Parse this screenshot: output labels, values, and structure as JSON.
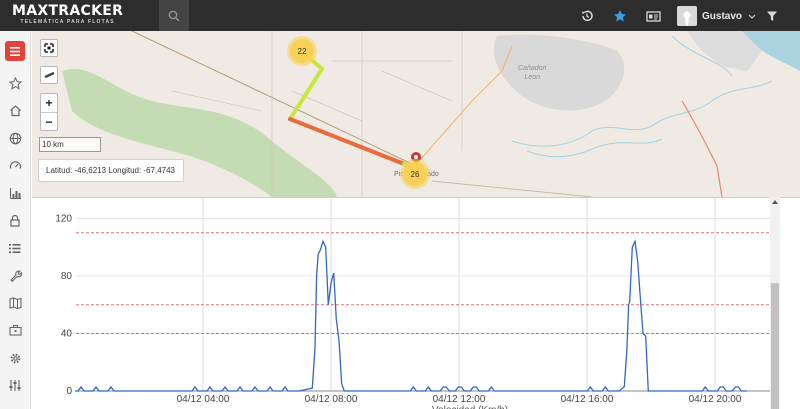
{
  "app": {
    "logo": "MAXTRACKER",
    "tagline": "TELEMÁTICA PARA FLOTAS"
  },
  "topbar": {
    "icons": [
      "search-icon",
      "history-icon",
      "star-icon",
      "id-card-icon",
      "filter-icon"
    ],
    "user_name": "Gustavo",
    "colors": {
      "background": "#2d2d2d",
      "star": "#3aa0e8"
    }
  },
  "sidebar": {
    "items": [
      {
        "name": "menu",
        "icon": "hamburger-icon",
        "active": true
      },
      {
        "name": "favorites",
        "icon": "star-icon"
      },
      {
        "name": "home",
        "icon": "home-icon"
      },
      {
        "name": "globe",
        "icon": "globe-icon"
      },
      {
        "name": "speed",
        "icon": "speedometer-icon"
      },
      {
        "name": "reports",
        "icon": "bar-chart-icon"
      },
      {
        "name": "lock",
        "icon": "lock-icon"
      },
      {
        "name": "list",
        "icon": "list-icon"
      },
      {
        "name": "tools",
        "icon": "wrench-icon"
      },
      {
        "name": "map",
        "icon": "map-icon"
      },
      {
        "name": "briefcase",
        "icon": "briefcase-icon"
      },
      {
        "name": "settings",
        "icon": "gear-icon"
      },
      {
        "name": "adjust",
        "icon": "sliders-icon"
      }
    ],
    "active_color": "#e0433a"
  },
  "map": {
    "place_label_1": "Cañadon",
    "place_label_2": "Leon",
    "town_label": "Pico Truncado",
    "scale_text": "10 km",
    "coords_text": "Latitud: -46,6213 Longitud: -67,4743",
    "clusters": [
      {
        "count": "22"
      },
      {
        "count": "26"
      }
    ],
    "colors": {
      "background": "#efebe4",
      "forest": "#c4dbb3",
      "urban": "#d9d9d9",
      "water": "#aad3df",
      "route_fast": "#e96a3a",
      "route_slow": "#c8e640",
      "cluster": "#f6d155"
    }
  },
  "chart_data": {
    "type": "line",
    "x_tick_labels": [
      "04/12 04:00",
      "04/12 08:00",
      "04/12 12:00",
      "04/12 16:00",
      "04/12 20:00"
    ],
    "xlabel": "Velocidad (Km/h)",
    "y_ticks": [
      0,
      40,
      80,
      120
    ],
    "ylim": [
      0,
      130
    ],
    "reference_lines": [
      40,
      60,
      110
    ],
    "series": [
      {
        "color": "#3566c0",
        "points": [
          [
            "04/12 00:00",
            0
          ],
          [
            "04/12 07:00",
            0
          ],
          [
            "04/12 07:25",
            2
          ],
          [
            "04/12 07:30",
            30
          ],
          [
            "04/12 07:33",
            80
          ],
          [
            "04/12 07:36",
            95
          ],
          [
            "04/12 07:40",
            98
          ],
          [
            "04/12 07:45",
            104
          ],
          [
            "04/12 07:50",
            100
          ],
          [
            "04/12 07:55",
            60
          ],
          [
            "04/12 08:00",
            75
          ],
          [
            "04/12 08:05",
            82
          ],
          [
            "04/12 08:10",
            50
          ],
          [
            "04/12 08:15",
            35
          ],
          [
            "04/12 08:20",
            5
          ],
          [
            "04/12 08:25",
            0
          ],
          [
            "04/12 17:00",
            0
          ],
          [
            "04/12 17:10",
            3
          ],
          [
            "04/12 17:15",
            30
          ],
          [
            "04/12 17:18",
            60
          ],
          [
            "04/12 17:20",
            62
          ],
          [
            "04/12 17:25",
            100
          ],
          [
            "04/12 17:30",
            104
          ],
          [
            "04/12 17:35",
            90
          ],
          [
            "04/12 17:40",
            65
          ],
          [
            "04/12 17:45",
            40
          ],
          [
            "04/12 17:50",
            38
          ],
          [
            "04/12 17:55",
            0
          ],
          [
            "04/12 21:00",
            0
          ]
        ]
      }
    ],
    "grid": true
  }
}
